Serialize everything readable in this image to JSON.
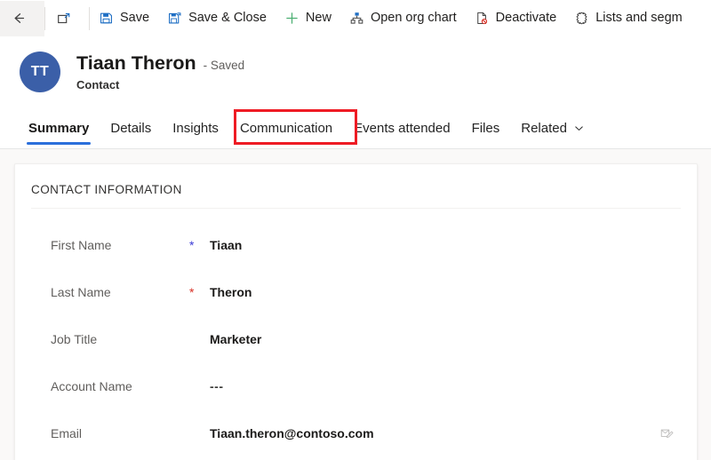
{
  "commandbar": {
    "buttons": [
      {
        "label": "",
        "icon": "back-arrow-icon",
        "name": "back-button"
      },
      {
        "label": "",
        "icon": "popout-icon",
        "name": "popout-button"
      },
      {
        "label": "Save",
        "icon": "save-icon",
        "name": "save-button"
      },
      {
        "label": "Save & Close",
        "icon": "save-and-close-icon",
        "name": "save-and-close-button"
      },
      {
        "label": "New",
        "icon": "plus-icon",
        "name": "new-button"
      },
      {
        "label": "Open org chart",
        "icon": "org-chart-icon",
        "name": "open-org-chart-button"
      },
      {
        "label": "Deactivate",
        "icon": "deactivate-icon",
        "name": "deactivate-button"
      },
      {
        "label": "Lists and segm",
        "icon": "lists-and-segments-icon",
        "name": "lists-and-segments-button"
      }
    ]
  },
  "record": {
    "avatar_initials": "TT",
    "name": "Tiaan Theron",
    "status": "- Saved",
    "entity": "Contact"
  },
  "tabs": [
    {
      "label": "Summary",
      "active": true,
      "chevron": false
    },
    {
      "label": "Details",
      "active": false,
      "chevron": false
    },
    {
      "label": "Insights",
      "active": false,
      "chevron": false
    },
    {
      "label": "Communication",
      "active": false,
      "chevron": false,
      "highlighted": true
    },
    {
      "label": "Events attended",
      "active": false,
      "chevron": false
    },
    {
      "label": "Files",
      "active": false,
      "chevron": false
    },
    {
      "label": "Related",
      "active": false,
      "chevron": true
    }
  ],
  "card": {
    "section_title": "CONTACT INFORMATION",
    "fields": [
      {
        "label": "First Name",
        "required": "recommended",
        "value": "Tiaan",
        "action_icon": ""
      },
      {
        "label": "Last Name",
        "required": "required",
        "value": "Theron",
        "action_icon": ""
      },
      {
        "label": "Job Title",
        "required": "none",
        "value": "Marketer",
        "action_icon": ""
      },
      {
        "label": "Account Name",
        "required": "none",
        "value": "---",
        "action_icon": ""
      },
      {
        "label": "Email",
        "required": "none",
        "value": "Tiaan.theron@contoso.com",
        "action_icon": "email-send-icon"
      }
    ]
  },
  "colors": {
    "accent_blue": "#2b6fdb",
    "avatar_blue": "#3b5fa8",
    "icon_blue": "#1f6fc4",
    "new_green": "#4caf72",
    "deactivate_red": "#d93025",
    "annotation_red": "#ee1b24",
    "required_red": "#d93025",
    "recommended_blue": "#3b3bd6",
    "body_background": "#faf9f8"
  }
}
